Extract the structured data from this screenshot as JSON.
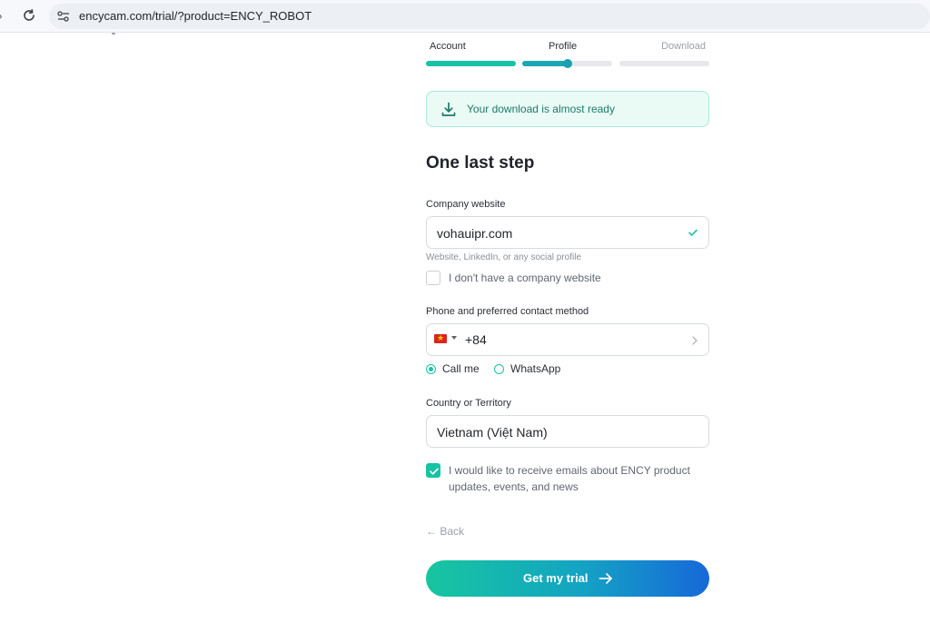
{
  "browser": {
    "url_host": "encycam.com",
    "url_path": "/trial/?product=ENCY_ROBOT"
  },
  "steps": [
    {
      "label": "Account",
      "state": "complete"
    },
    {
      "label": "Profile",
      "state": "current",
      "progress": 0.5
    },
    {
      "label": "Download",
      "state": "pending"
    }
  ],
  "notice": {
    "text": "Your download is almost ready"
  },
  "form": {
    "heading": "One last step",
    "website": {
      "label": "Company website",
      "value": "vohauipr.com",
      "hint": "Website, LinkedIn, or any social profile",
      "no_website_label": "I don't have a company website"
    },
    "phone": {
      "label": "Phone and preferred contact method",
      "dial_code": "+84",
      "country_flag": "vietnam-flag",
      "methods": [
        {
          "label": "Call me",
          "selected": true
        },
        {
          "label": "WhatsApp",
          "selected": false
        }
      ]
    },
    "country": {
      "label": "Country or Territory",
      "value": "Vietnam (Việt Nam)"
    },
    "emails_consent": {
      "label": "I would like to receive emails about ENCY product updates, events, and news",
      "checked": true
    },
    "back_label": "← Back",
    "submit_label": "Get my trial"
  },
  "colors": {
    "accent": "#17c3a4",
    "cta_start": "#16c69f",
    "cta_end": "#1768d9"
  }
}
